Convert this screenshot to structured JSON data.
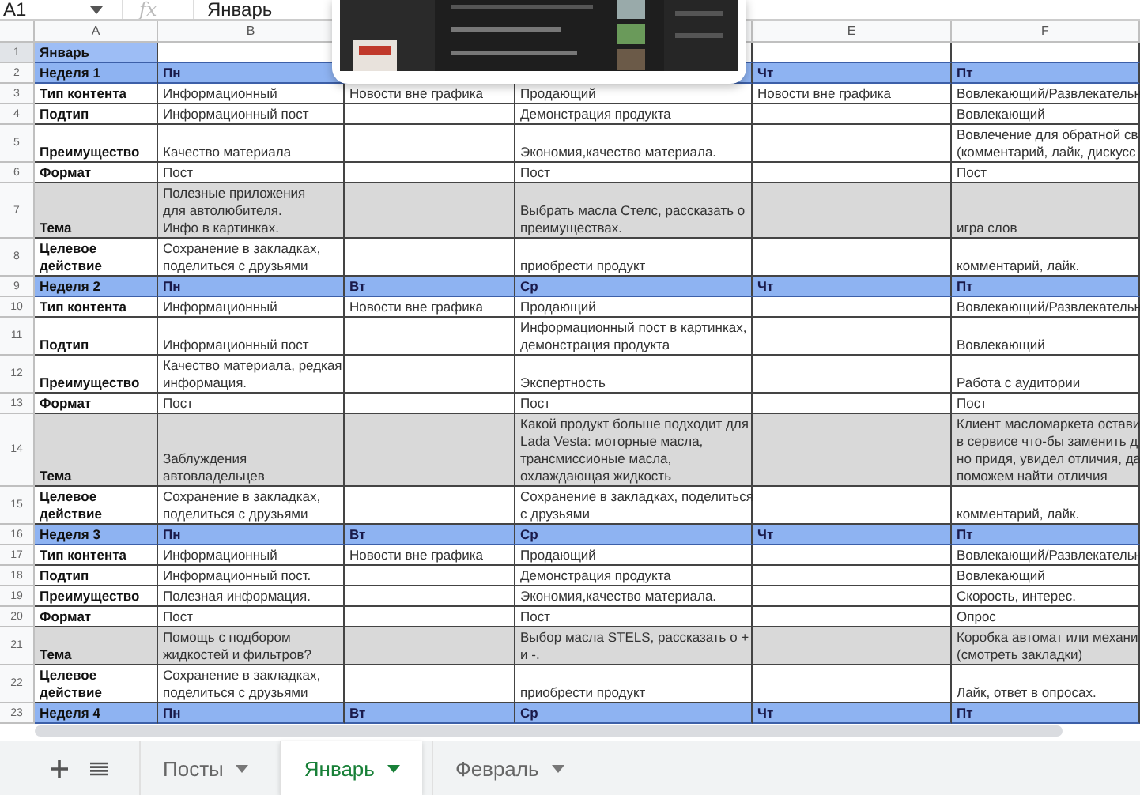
{
  "formula_bar": {
    "cell_ref": "A1",
    "function_label": "fx",
    "value": "Январь"
  },
  "columns": [
    {
      "label": "A"
    },
    {
      "label": "B"
    },
    {},
    {},
    {
      "label": "E"
    },
    {
      "label": "F"
    }
  ],
  "rows": [
    {
      "number": "1",
      "kind": "title",
      "selected": true,
      "cells": {
        "A": "Январь"
      }
    },
    {
      "number": "2",
      "kind": "week",
      "selected": false,
      "cells": {
        "A": "Неделя 1",
        "B": "Пн",
        "E": "Чт",
        "F": "Пт"
      }
    },
    {
      "number": "3",
      "kind": "normal",
      "selected": false,
      "cells": {
        "A": "Тип контента",
        "B": "Информационный",
        "C": "Новости вне графика",
        "D": "Продающий",
        "E": "Новости вне графика",
        "F": "Вовлекающий/Развлекательн"
      }
    },
    {
      "number": "4",
      "kind": "normal",
      "selected": false,
      "cells": {
        "A": "Подтип",
        "B": "Информационный пост",
        "D": "Демонстрация продукта",
        "F": "Вовлекающий"
      }
    },
    {
      "number": "5",
      "kind": "normal",
      "selected": false,
      "cells": {
        "A": "Преимущество",
        "B": "Качество материала",
        "D": "Экономия,качество материала.",
        "F": "Вовлечение для обратной св\n(комментарий, лайк, дискусс"
      }
    },
    {
      "number": "6",
      "kind": "normal",
      "selected": false,
      "cells": {
        "A": "Формат",
        "B": "Пост",
        "D": "Пост",
        "F": "Пост"
      }
    },
    {
      "number": "7",
      "kind": "topic",
      "selected": false,
      "cells": {
        "A": "Тема",
        "B": "Полезные приложения\nдля автолюбителя.\nИнфо в картинках.",
        "D": "Выбрать масла Стелс, рассказать о\nпреимуществах.",
        "F": "игра слов"
      }
    },
    {
      "number": "8",
      "kind": "normal",
      "selected": false,
      "cells": {
        "A": "Целевое\nдействие",
        "B": "Сохранение в закладках,\nподелиться с друзьями",
        "D": "приобрести продукт",
        "F": "комментарий, лайк."
      }
    },
    {
      "number": "9",
      "kind": "week",
      "selected": false,
      "cells": {
        "A": "Неделя 2",
        "B": "Пн",
        "C": "Вт",
        "D": "Ср",
        "E": "Чт",
        "F": "Пт"
      }
    },
    {
      "number": "10",
      "kind": "normal",
      "selected": false,
      "cells": {
        "A": "Тип контента",
        "B": "Информационный",
        "C": "Новости вне графика",
        "D": "Продающий",
        "F": "Вовлекающий/Развлекательн"
      }
    },
    {
      "number": "11",
      "kind": "normal",
      "selected": false,
      "cells": {
        "A": "Подтип",
        "B": "Информационный пост",
        "D": "Информационный пост в картинках,\nдемонстрация продукта",
        "F": "Вовлекающий"
      }
    },
    {
      "number": "12",
      "kind": "normal",
      "selected": false,
      "cells": {
        "A": "Преимущество",
        "B": "Качество материала, редкая\nинформация.",
        "D": "Экспертность",
        "F": "Работа с аудитории"
      }
    },
    {
      "number": "13",
      "kind": "normal",
      "selected": false,
      "cells": {
        "A": "Формат",
        "B": "Пост",
        "D": "Пост",
        "F": "Пост"
      }
    },
    {
      "number": "14",
      "kind": "topic",
      "selected": false,
      "cells": {
        "A": "Тема",
        "B": "Заблуждения\nавтовладельцев",
        "D": "Какой продукт больше подходит для\nLada Vesta: моторные масла,\nтрансмиссионые масла,\nохлаждающая жидкость",
        "F": "Клиент масломаркета остави\nв сервисе что-бы заменить д\nно придя, увидел отличия, да\nпоможем найти отличия"
      }
    },
    {
      "number": "15",
      "kind": "normal",
      "selected": false,
      "cells": {
        "A": "Целевое\nдействие",
        "B": "Сохранение в закладках,\nподелиться с друзьями",
        "D": "Сохранение в закладках, поделиться\nс друзьями",
        "F": "комментарий, лайк."
      }
    },
    {
      "number": "16",
      "kind": "week",
      "selected": false,
      "cells": {
        "A": "Неделя 3",
        "B": "Пн",
        "C": "Вт",
        "D": "Ср",
        "E": "Чт",
        "F": "Пт"
      }
    },
    {
      "number": "17",
      "kind": "normal",
      "selected": false,
      "cells": {
        "A": "Тип контента",
        "B": "Информационный",
        "C": "Новости вне графика",
        "D": "Продающий",
        "F": "Вовлекающий/Развлекательн"
      }
    },
    {
      "number": "18",
      "kind": "normal",
      "selected": false,
      "cells": {
        "A": "Подтип",
        "B": "Информационный пост.",
        "D": "Демонстрация продукта",
        "F": "Вовлекающий"
      }
    },
    {
      "number": "19",
      "kind": "normal",
      "selected": false,
      "cells": {
        "A": "Преимущество",
        "B": "Полезная информация.",
        "D": "Экономия,качество материала.",
        "F": "Скорость, интерес."
      }
    },
    {
      "number": "20",
      "kind": "normal",
      "selected": false,
      "cells": {
        "A": "Формат",
        "B": "Пост",
        "D": "Пост",
        "F": "Опрос"
      }
    },
    {
      "number": "21",
      "kind": "topic",
      "selected": false,
      "cells": {
        "A": "Тема",
        "B": "Помощь с подбором\nжидкостей и фильтров?",
        "D": "Выбор масла STELS, рассказать о +\nи -.",
        "F": "Коробка автомат или механи\n(смотреть закладки)"
      }
    },
    {
      "number": "22",
      "kind": "normal",
      "selected": false,
      "cells": {
        "A": "Целевое\nдействие",
        "B": "Сохранение в закладках,\nподелиться с друзьями",
        "D": "приобрести продукт",
        "F": "Лайк, ответ в опросах."
      }
    },
    {
      "number": "23",
      "kind": "week",
      "selected": false,
      "cells": {
        "A": "Неделя 4",
        "B": "Пн",
        "C": "Вт",
        "D": "Ср",
        "E": "Чт",
        "F": "Пт"
      }
    }
  ],
  "sheet_tabs": [
    {
      "label": "Посты",
      "selected": false
    },
    {
      "label": "Январь",
      "selected": true
    },
    {
      "label": "Февраль",
      "selected": false
    }
  ]
}
